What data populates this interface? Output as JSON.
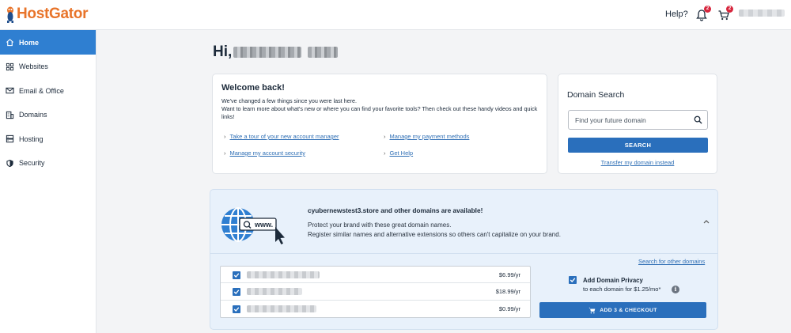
{
  "brand": {
    "logo_text": "HostGator",
    "accent": "#e8742a",
    "primary": "#2a6fbc"
  },
  "header": {
    "help_label": "Help?",
    "notifications_count": "2",
    "cart_count": "2",
    "icons": [
      "bell-icon",
      "cart-icon"
    ]
  },
  "sidebar": {
    "items": [
      {
        "label": "Home",
        "icon": "home-icon",
        "active": true
      },
      {
        "label": "Websites",
        "icon": "grid-icon"
      },
      {
        "label": "Email & Office",
        "icon": "mail-icon"
      },
      {
        "label": "Domains",
        "icon": "building-icon"
      },
      {
        "label": "Hosting",
        "icon": "server-icon"
      },
      {
        "label": "Security",
        "icon": "shield-icon"
      }
    ]
  },
  "greeting": {
    "prefix": "Hi,"
  },
  "welcome": {
    "title": "Welcome back!",
    "line1": "We've changed a few things since you were last here.",
    "line2": "Want to learn more about what's new or where you can find your favorite tools? Then check out these handy videos and quick links!",
    "links": [
      "Take a tour of your new account manager",
      "Manage my payment methods",
      "Manage my account security",
      "Get Help"
    ]
  },
  "domain_search": {
    "title": "Domain Search",
    "placeholder": "Find your future domain",
    "button_label": "SEARCH",
    "transfer_link": "Transfer my domain instead"
  },
  "suggestions": {
    "globe_text": "www.",
    "title": "cyubernewstest3.store and other domains are available!",
    "line1": "Protect your brand with these great domain names.",
    "line2": "Register similar names and alternative extensions so others can't capitalize on your brand.",
    "search_other": "Search for other domains",
    "domains": [
      {
        "price": "$6.99/yr",
        "checked": true
      },
      {
        "price": "$18.99/yr",
        "checked": true
      },
      {
        "price": "$0.99/yr",
        "checked": true
      }
    ],
    "privacy_title": "Add Domain Privacy",
    "privacy_sub": "to each domain for  $1.25/mo*",
    "info_glyph": "i",
    "checkout_label": "ADD 3 & CHECKOUT"
  }
}
